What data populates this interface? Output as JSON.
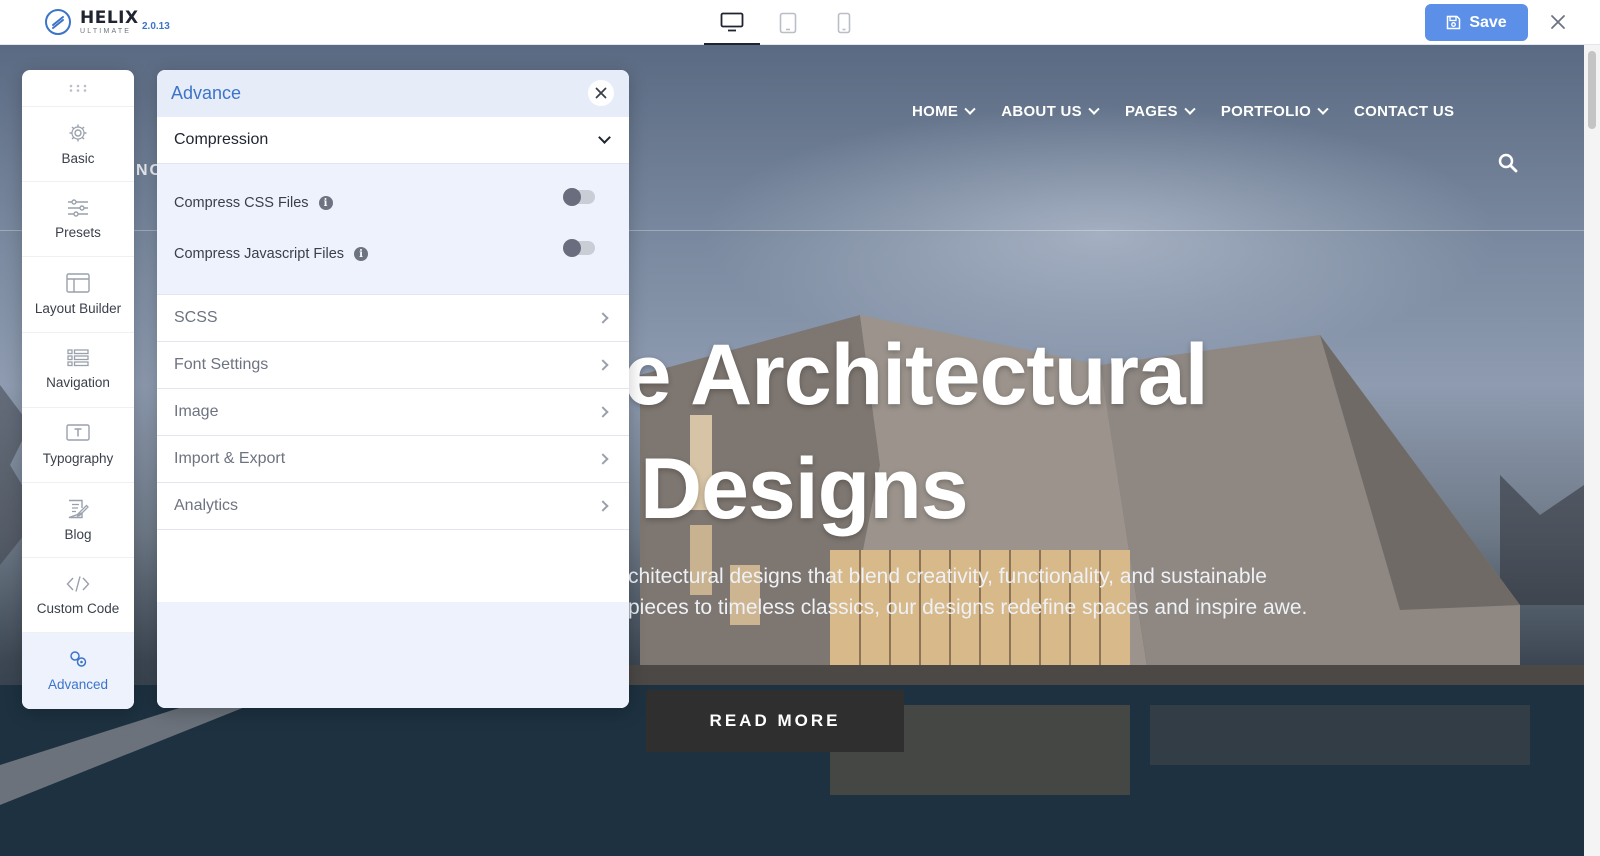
{
  "app": {
    "brand": "HELIX",
    "brand_sub": "ULTIMATE",
    "version": "2.0.13",
    "save_label": "Save",
    "accent_color": "#5b8fe8"
  },
  "devices": [
    {
      "name": "desktop-icon",
      "active": true
    },
    {
      "name": "tablet-icon",
      "active": false
    },
    {
      "name": "mobile-icon",
      "active": false
    }
  ],
  "site": {
    "partial_logo": "NC",
    "nav": [
      "HOME",
      "ABOUT US",
      "PAGES",
      "PORTFOLIO",
      "CONTACT US"
    ],
    "hero_line1": "te Architectural",
    "hero_line2": "Designs",
    "hero_text1": "chitectural designs that blend creativity, functionality, and sustainable",
    "hero_text2": "pieces to timeless classics, our designs redefine spaces and inspire awe.",
    "read_more": "READ MORE"
  },
  "sidebar": {
    "items": [
      {
        "label": "Basic",
        "icon": "gear-icon"
      },
      {
        "label": "Presets",
        "icon": "sliders-icon"
      },
      {
        "label": "Layout Builder",
        "icon": "layout-icon"
      },
      {
        "label": "Navigation",
        "icon": "list-icon"
      },
      {
        "label": "Typography",
        "icon": "typography-icon"
      },
      {
        "label": "Blog",
        "icon": "blog-icon"
      },
      {
        "label": "Custom Code",
        "icon": "code-icon"
      },
      {
        "label": "Advanced",
        "icon": "advanced-icon",
        "active": true
      }
    ]
  },
  "panel": {
    "title": "Advance",
    "open_section": "Compression",
    "options": [
      {
        "label": "Compress CSS Files",
        "enabled": false
      },
      {
        "label": "Compress Javascript Files",
        "enabled": false
      }
    ],
    "sections": [
      "SCSS",
      "Font Settings",
      "Image",
      "Import & Export",
      "Analytics"
    ]
  }
}
